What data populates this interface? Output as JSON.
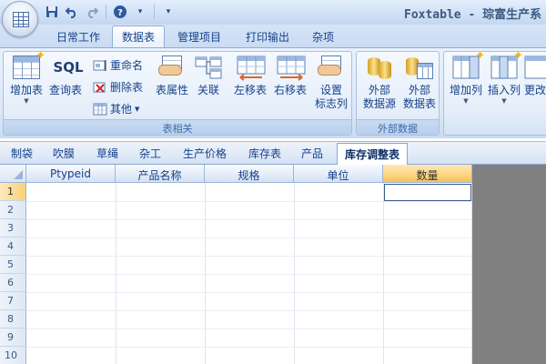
{
  "window": {
    "title": "Foxtable - 琮富生产系"
  },
  "quick_access": {
    "save_icon": "save-icon",
    "undo_icon": "undo-icon",
    "redo_icon": "redo-icon",
    "help_icon": "help-icon",
    "customize_icon": "customize-dropdown-icon"
  },
  "ribbon_tabs": [
    {
      "label": "日常工作"
    },
    {
      "label": "数据表"
    },
    {
      "label": "管理项目"
    },
    {
      "label": "打印输出"
    },
    {
      "label": "杂项"
    }
  ],
  "ribbon_active_tab": "数据表",
  "groups": {
    "table": {
      "label": "表相关",
      "add_table": "增加表",
      "query_table": "查询表",
      "sql_icon_text": "SQL",
      "rename": "重命名",
      "delete_table": "删除表",
      "other": "其他",
      "table_props": "表属性",
      "relation": "关联",
      "move_left": "左移表",
      "move_right": "右移表",
      "set_flag_line1": "设置",
      "set_flag_line2": "标志列"
    },
    "external": {
      "label": "外部数据",
      "ext_source_line1": "外部",
      "ext_source_line2": "数据源",
      "ext_table_line1": "外部",
      "ext_table_line2": "数据表"
    },
    "columns": {
      "add_column": "增加列",
      "insert_column": "插入列",
      "change_column": "更改"
    }
  },
  "sheet_tabs": [
    {
      "label": "制袋"
    },
    {
      "label": "吹膜"
    },
    {
      "label": "草绳"
    },
    {
      "label": "杂工"
    },
    {
      "label": "生产价格"
    },
    {
      "label": "库存表"
    },
    {
      "label": "产品"
    },
    {
      "label": "库存调整表"
    }
  ],
  "active_sheet": "库存调整表",
  "grid": {
    "columns": [
      "Ptypeid",
      "产品名称",
      "规格",
      "单位",
      "数量"
    ],
    "selected_column": "数量",
    "row_numbers": [
      "1",
      "2",
      "3",
      "4",
      "5",
      "6",
      "7",
      "8",
      "9",
      "10"
    ],
    "selected_row": "1"
  }
}
